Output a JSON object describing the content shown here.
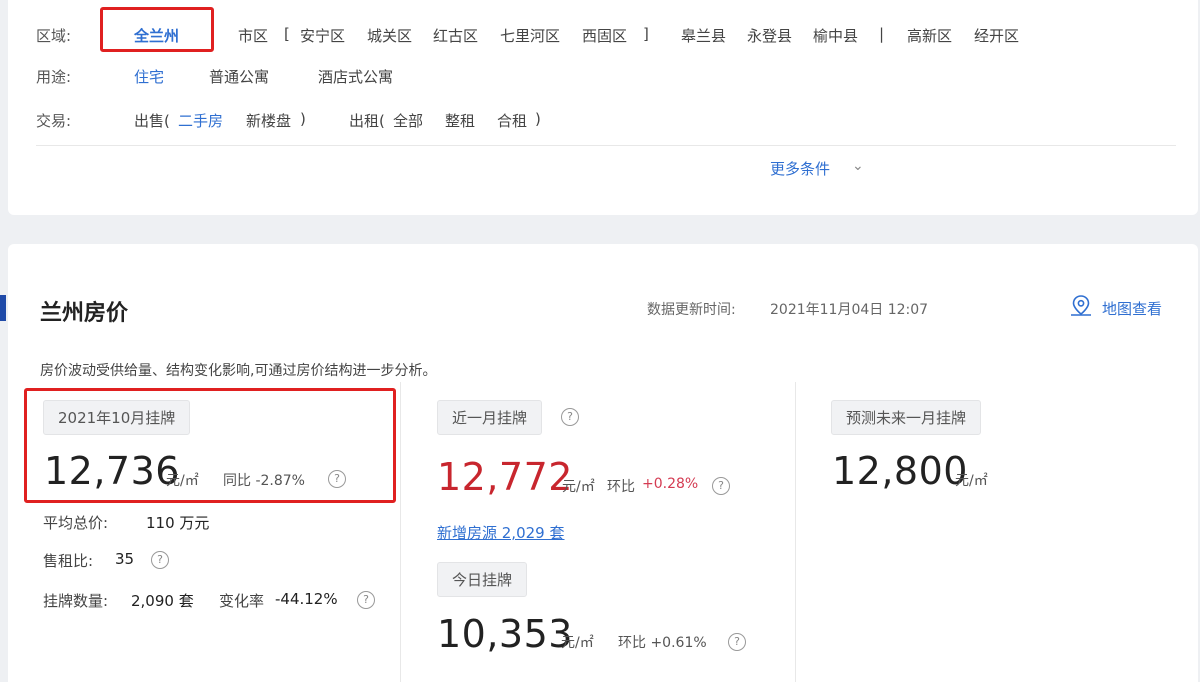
{
  "filters": {
    "region": {
      "label": "区域:",
      "all": "全兰州",
      "city": "市区",
      "open_bracket": "[",
      "districts": [
        "安宁区",
        "城关区",
        "红古区",
        "七里河区",
        "西固区"
      ],
      "close_bracket": "]",
      "counties": [
        "皋兰县",
        "永登县",
        "榆中县"
      ],
      "separator": "|",
      "zones": [
        "高新区",
        "经开区"
      ]
    },
    "usage": {
      "label": "用途:",
      "items": [
        "住宅",
        "普通公寓",
        "酒店式公寓"
      ]
    },
    "trade": {
      "label": "交易:",
      "sale_open": "出售(",
      "sale_second": "二手房",
      "sale_new": "新楼盘",
      "sale_close": ")",
      "rent_open": "出租(",
      "rent_all": "全部",
      "rent_whole": "整租",
      "rent_shared": "合租",
      "rent_close": ")"
    },
    "more": "更多条件"
  },
  "price": {
    "title": "兰州房价",
    "update_label": "数据更新时间:",
    "update_time": "2021年11月04日 12:07",
    "map_link": "地图查看",
    "description": "房价波动受供给量、结构变化影响,可通过房价结构进一步分析。",
    "month": {
      "tag": "2021年10月挂牌",
      "value": "12,736",
      "unit": "元/㎡",
      "yoy": "同比 -2.87%",
      "avg_total_label": "平均总价:",
      "avg_total": "110 万元",
      "rent_ratio_label": "售租比:",
      "rent_ratio": "35",
      "count_label": "挂牌数量:",
      "count": "2,090 套",
      "change_label": "变化率",
      "change": "-44.12%"
    },
    "recent": {
      "tag": "近一月挂牌",
      "value": "12,772",
      "unit": "元/㎡",
      "mom_label": "环比",
      "mom": "+0.28%",
      "new_listings": "新增房源 2,029 套",
      "today_tag": "今日挂牌",
      "today_value": "10,353",
      "today_unit": "元/㎡",
      "today_mom": "环比 +0.61%"
    },
    "forecast": {
      "tag": "预测未来一月挂牌",
      "value": "12,800",
      "unit": "元/㎡"
    }
  },
  "colors": {
    "accent": "#2f6fd1",
    "highlight_box": "#e02020",
    "price_red": "#c8262e",
    "negative_green": "#2e8b2e"
  }
}
